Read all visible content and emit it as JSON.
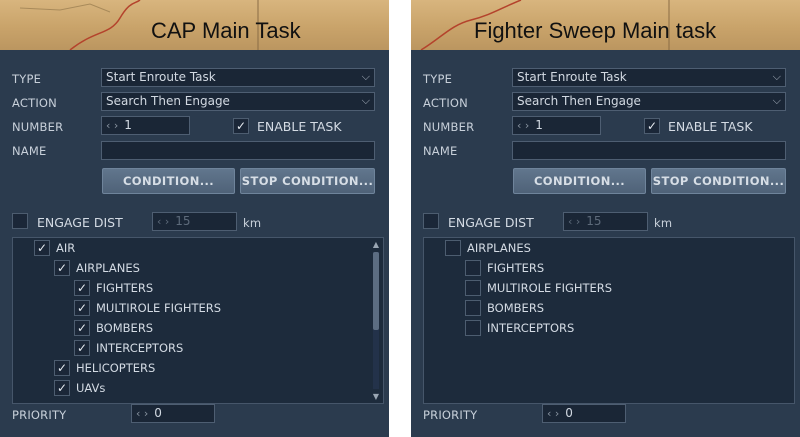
{
  "left": {
    "caption": "CAP Main Task",
    "type_label": "TYPE",
    "type_value": "Start Enroute Task",
    "action_label": "ACTION",
    "action_value": "Search Then Engage",
    "number_label": "NUMBER",
    "number_value": "1",
    "enable_task_label": "ENABLE TASK",
    "enable_task_checked": "✓",
    "name_label": "NAME",
    "condition_button": "CONDITION...",
    "stop_condition_button": "STOP CONDITION...",
    "engage_dist_label": "ENGAGE DIST",
    "engage_dist_value": "15",
    "engage_dist_unit": "km",
    "tree": [
      {
        "label": "AIR",
        "check": "✓"
      },
      {
        "label": "AIRPLANES",
        "check": "✓"
      },
      {
        "label": "FIGHTERS",
        "check": "✓"
      },
      {
        "label": "MULTIROLE FIGHTERS",
        "check": "✓"
      },
      {
        "label": "BOMBERS",
        "check": "✓"
      },
      {
        "label": "INTERCEPTORS",
        "check": "✓"
      },
      {
        "label": "HELICOPTERS",
        "check": "✓"
      },
      {
        "label": "UAVs",
        "check": "✓"
      }
    ],
    "priority_label": "PRIORITY",
    "priority_value": "0"
  },
  "right": {
    "caption": "Fighter Sweep Main task",
    "type_label": "TYPE",
    "type_value": "Start Enroute Task",
    "action_label": "ACTION",
    "action_value": "Search Then Engage",
    "number_label": "NUMBER",
    "number_value": "1",
    "enable_task_label": "ENABLE TASK",
    "enable_task_checked": "✓",
    "name_label": "NAME",
    "condition_button": "CONDITION...",
    "stop_condition_button": "STOP CONDITION...",
    "engage_dist_label": "ENGAGE DIST",
    "engage_dist_value": "15",
    "engage_dist_unit": "km",
    "tree": [
      {
        "label": "AIRPLANES",
        "check": ""
      },
      {
        "label": "FIGHTERS",
        "check": ""
      },
      {
        "label": "MULTIROLE FIGHTERS",
        "check": ""
      },
      {
        "label": "BOMBERS",
        "check": ""
      },
      {
        "label": "INTERCEPTORS",
        "check": ""
      }
    ],
    "priority_label": "PRIORITY",
    "priority_value": "0"
  },
  "icons": {
    "dropdown_chevron": "chevron-down-icon",
    "spin_arrows": "spin-arrows-icon",
    "checkmark": "checkmark-icon",
    "scroll_up": "scroll-up-icon",
    "scroll_down": "scroll-down-icon"
  },
  "colors": {
    "panel_bg": "#2b3b4e",
    "field_bg": "#1a2636",
    "button_bg": "#5a6e85",
    "map_bg": "#d2ad74"
  }
}
